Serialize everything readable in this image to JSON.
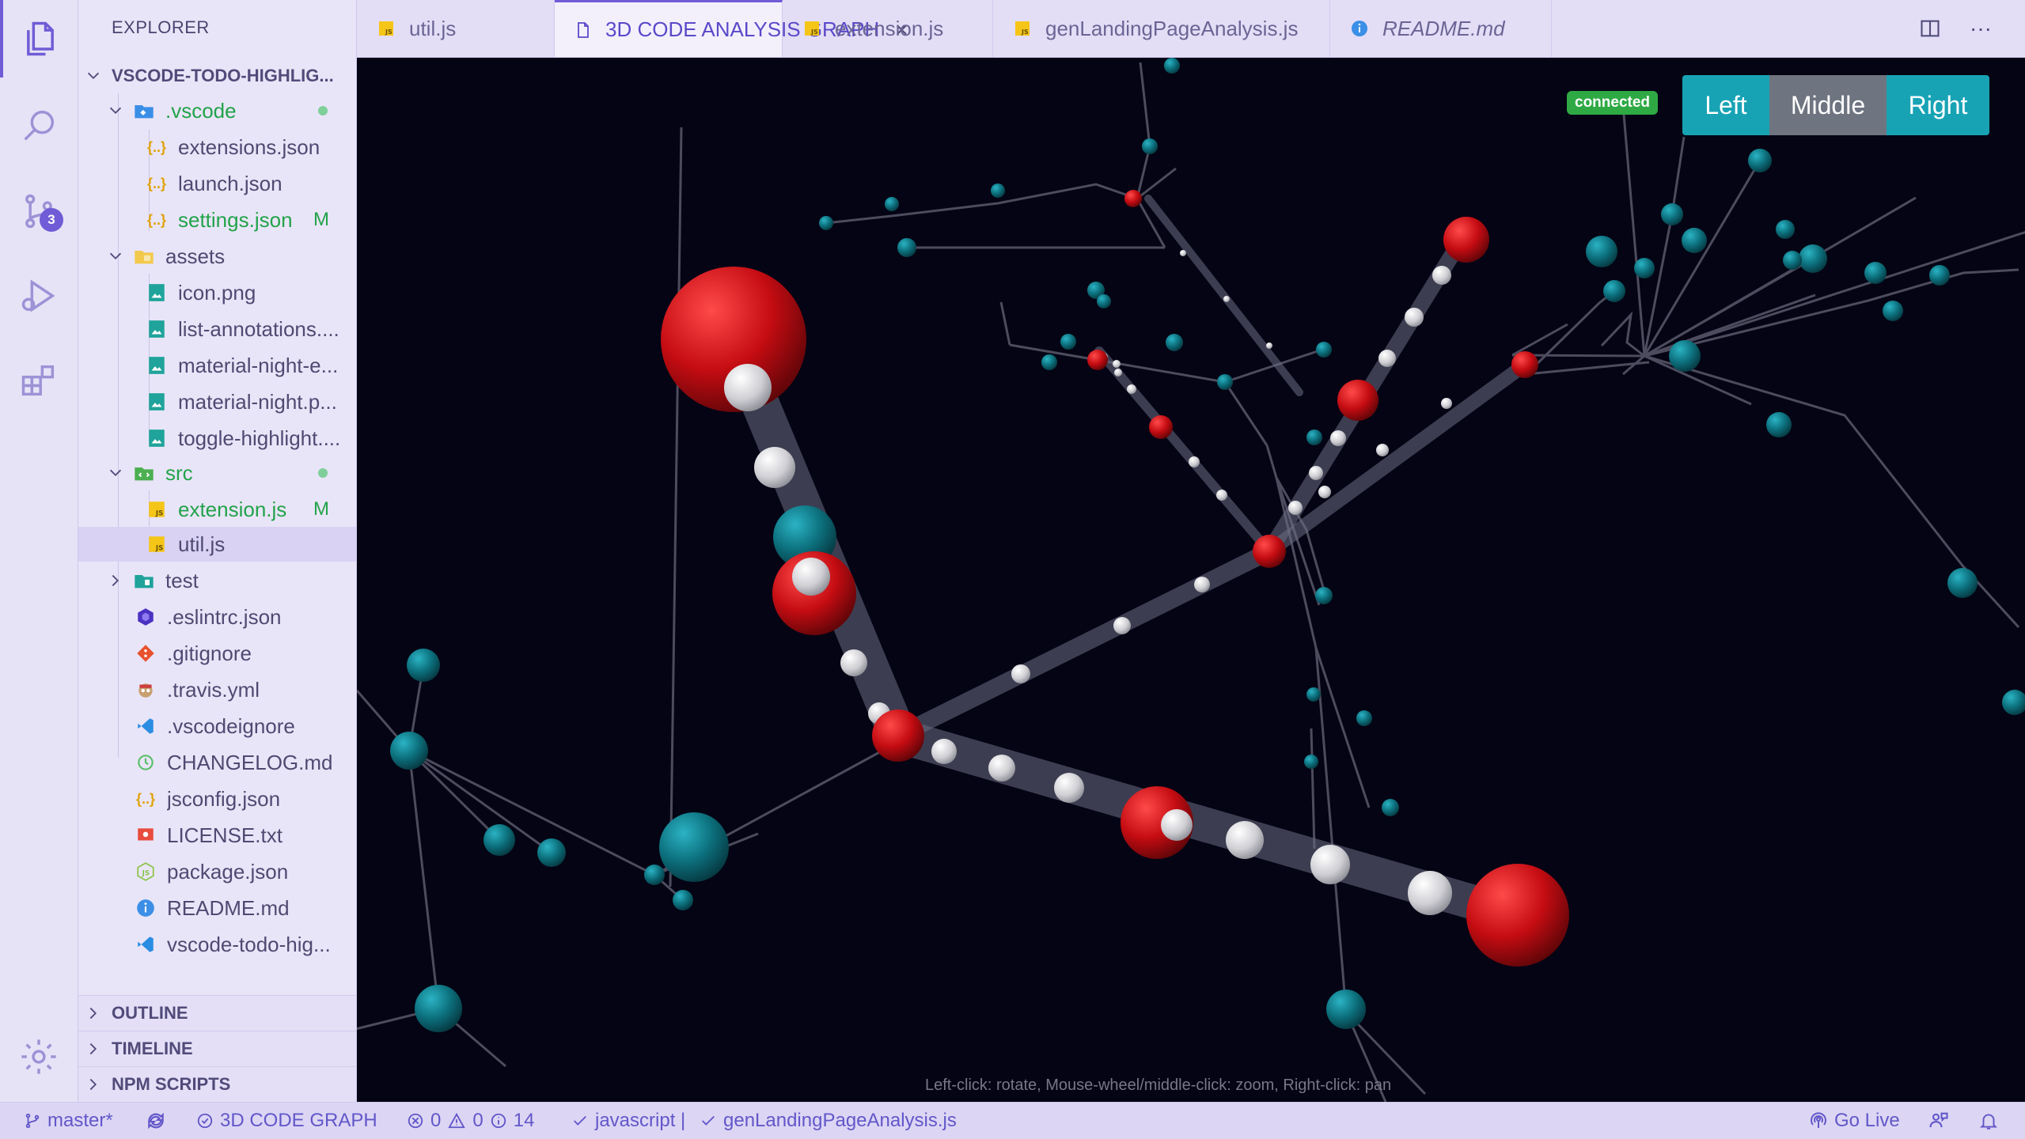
{
  "activity_bar": {
    "items": [
      {
        "name": "files-icon"
      },
      {
        "name": "search-icon"
      },
      {
        "name": "source-control-icon",
        "badge": "3"
      },
      {
        "name": "run-debug-icon"
      },
      {
        "name": "extensions-icon"
      }
    ],
    "settings_icon": "gear-icon"
  },
  "sidebar": {
    "title": "EXPLORER",
    "root": "VSCODE-TODO-HIGHLIG...",
    "tree": [
      {
        "label": ".vscode",
        "type": "folder",
        "modified": true
      },
      {
        "label": "extensions.json",
        "type": "json"
      },
      {
        "label": "launch.json",
        "type": "json"
      },
      {
        "label": "settings.json",
        "type": "json",
        "flag": "M"
      },
      {
        "label": "assets",
        "type": "folder"
      },
      {
        "label": "icon.png",
        "type": "image"
      },
      {
        "label": "list-annotations....",
        "type": "image"
      },
      {
        "label": "material-night-e...",
        "type": "image"
      },
      {
        "label": "material-night.p...",
        "type": "image"
      },
      {
        "label": "toggle-highlight....",
        "type": "image"
      },
      {
        "label": "src",
        "type": "folder",
        "modified": true
      },
      {
        "label": "extension.js",
        "type": "js",
        "flag": "M"
      },
      {
        "label": "util.js",
        "type": "js"
      },
      {
        "label": "test",
        "type": "folder"
      },
      {
        "label": ".eslintrc.json",
        "type": "eslint"
      },
      {
        "label": ".gitignore",
        "type": "git"
      },
      {
        "label": ".travis.yml",
        "type": "travis"
      },
      {
        "label": ".vscodeignore",
        "type": "vscode"
      },
      {
        "label": "CHANGELOG.md",
        "type": "changelog"
      },
      {
        "label": "jsconfig.json",
        "type": "json"
      },
      {
        "label": "LICENSE.txt",
        "type": "license"
      },
      {
        "label": "package.json",
        "type": "npm"
      },
      {
        "label": "README.md",
        "type": "info"
      },
      {
        "label": "vscode-todo-hig...",
        "type": "vscode"
      }
    ],
    "sections": [
      "OUTLINE",
      "TIMELINE",
      "NPM SCRIPTS"
    ]
  },
  "tabs": [
    {
      "label": "util.js",
      "icon": "js-file-icon"
    },
    {
      "label": "3D CODE ANALYSIS GRAPH",
      "icon": "preview-file-icon",
      "active": true
    },
    {
      "label": "extension.js",
      "icon": "js-file-icon"
    },
    {
      "label": "genLandingPageAnalysis.js",
      "icon": "js-file-icon"
    },
    {
      "label": "README.md",
      "icon": "info-icon",
      "italic": true
    }
  ],
  "tab_close": "×",
  "tab_actions": {
    "split": "split-editor-icon",
    "more": "···"
  },
  "graph": {
    "status_badge": "connected",
    "buttons": {
      "left": "Left",
      "middle": "Middle",
      "right": "Right"
    },
    "hint": "Left-click: rotate, Mouse-wheel/middle-click: zoom, Right-click: pan",
    "colors": {
      "background": "#040414",
      "red_node": "#c40c12",
      "teal_node": "#0c6f7c",
      "edge": "#5a5a6e",
      "particle": "#d9d9d9"
    }
  },
  "status_bar": {
    "branch": "master*",
    "graph_label": "3D CODE GRAPH",
    "errors": "0",
    "warnings": "0",
    "infos": "14",
    "language": "javascript |",
    "file": "genLandingPageAnalysis.js",
    "go_live": "Go Live"
  }
}
